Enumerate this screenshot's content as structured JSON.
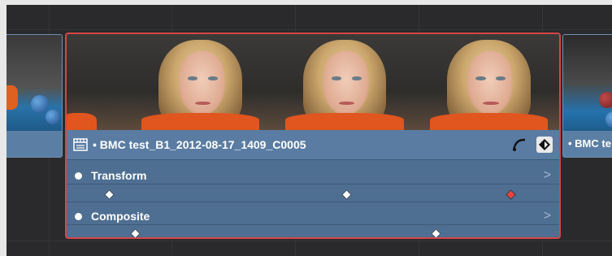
{
  "timeline": {
    "clip": {
      "name": "• BMC test_B1_2012-08-17_1409_C0005",
      "selected": true,
      "icons": {
        "type": "clip-film-icon",
        "curve": "curve-editor-icon",
        "keyframe_toggle": "keyframe-diamond-icon"
      },
      "keyframe_tracks": [
        {
          "label": "Transform",
          "chevron": ">",
          "keyframes": [
            {
              "color": "white"
            },
            {
              "color": "white"
            },
            {
              "color": "red"
            }
          ]
        },
        {
          "label": "Composite",
          "chevron": ">",
          "keyframes": [
            {
              "color": "white"
            },
            {
              "color": "white"
            }
          ]
        }
      ]
    },
    "next_clip": {
      "name": "• BMC te"
    },
    "colors": {
      "clip_body": "#5a7ca2",
      "selection_border": "#d64545",
      "selected_keyframe": "#e8443a",
      "background": "#2a2a2c"
    }
  }
}
